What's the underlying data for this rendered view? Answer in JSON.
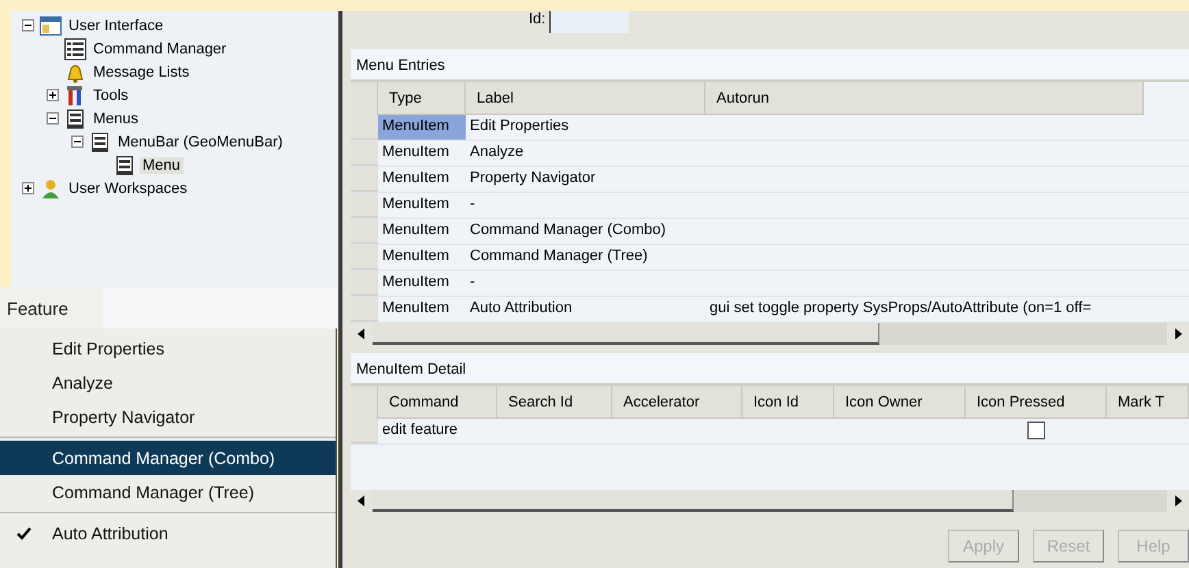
{
  "tree": [
    {
      "label": "User Interface",
      "kind": "window",
      "expanded": true,
      "children": [
        {
          "label": "Command Manager",
          "kind": "list"
        },
        {
          "label": "Message Lists",
          "kind": "bell"
        },
        {
          "label": "Tools",
          "kind": "tools",
          "expanded": false
        },
        {
          "label": "Menus",
          "kind": "menu",
          "expanded": true,
          "children": [
            {
              "label": "MenuBar (GeoMenuBar)",
              "kind": "menu",
              "expanded": true,
              "children": [
                {
                  "label": "Menu",
                  "kind": "menu",
                  "selected": true
                }
              ]
            }
          ]
        }
      ]
    },
    {
      "label": "User Workspaces",
      "kind": "user",
      "expanded": false,
      "selected": false
    }
  ],
  "menu": {
    "title": "Feature",
    "items": [
      {
        "kind": "item",
        "label": "Edit Properties",
        "selected": false,
        "checked": false
      },
      {
        "kind": "item",
        "label": "Analyze",
        "selected": false,
        "checked": false
      },
      {
        "kind": "item",
        "label": "Property Navigator",
        "selected": false,
        "checked": false
      },
      {
        "kind": "separator"
      },
      {
        "kind": "item",
        "label": "Command Manager (Combo)",
        "selected": true,
        "checked": false
      },
      {
        "kind": "item",
        "label": "Command Manager (Tree)",
        "selected": false,
        "checked": false
      },
      {
        "kind": "separator"
      },
      {
        "kind": "item",
        "label": "Auto Attribution",
        "selected": false,
        "checked": true
      }
    ]
  },
  "id_field": {
    "label": "Id:"
  },
  "menu_entries": {
    "title": "Menu Entries",
    "columns": [
      "Type",
      "Label",
      "Autorun"
    ],
    "rows": [
      {
        "type": "MenuItem",
        "label": "Edit Properties",
        "selected": true
      },
      {
        "type": "MenuItem",
        "label": "Analyze",
        "selected": false
      },
      {
        "type": "MenuItem",
        "label": "Property Navigator",
        "selected": false
      },
      {
        "type": "MenuItem",
        "label": "-",
        "selected": false
      },
      {
        "type": "MenuItem",
        "label": "Command Manager (Combo)",
        "selected": false
      },
      {
        "type": "MenuItem",
        "label": "Command Manager (Tree)",
        "selected": false
      },
      {
        "type": "MenuItem",
        "label": "-",
        "selected": false
      },
      {
        "type": "MenuItem",
        "label": "Auto Attribution",
        "autorun": "gui set toggle property SysProps/AutoAttribute (on=1 off=",
        "selected": false
      }
    ]
  },
  "detail": {
    "title": "MenuItem Detail",
    "columns": [
      "Command",
      "Search Id",
      "Accelerator",
      "Icon Id",
      "Icon Owner",
      "Icon Pressed",
      "Mark T"
    ],
    "rows": [
      {
        "command": "edit feature",
        "icon_pressed": false
      }
    ]
  },
  "buttons": [
    {
      "label": "Apply",
      "disabled": true
    },
    {
      "label": "Reset",
      "disabled": true
    },
    {
      "label": "Help",
      "disabled": true
    }
  ]
}
